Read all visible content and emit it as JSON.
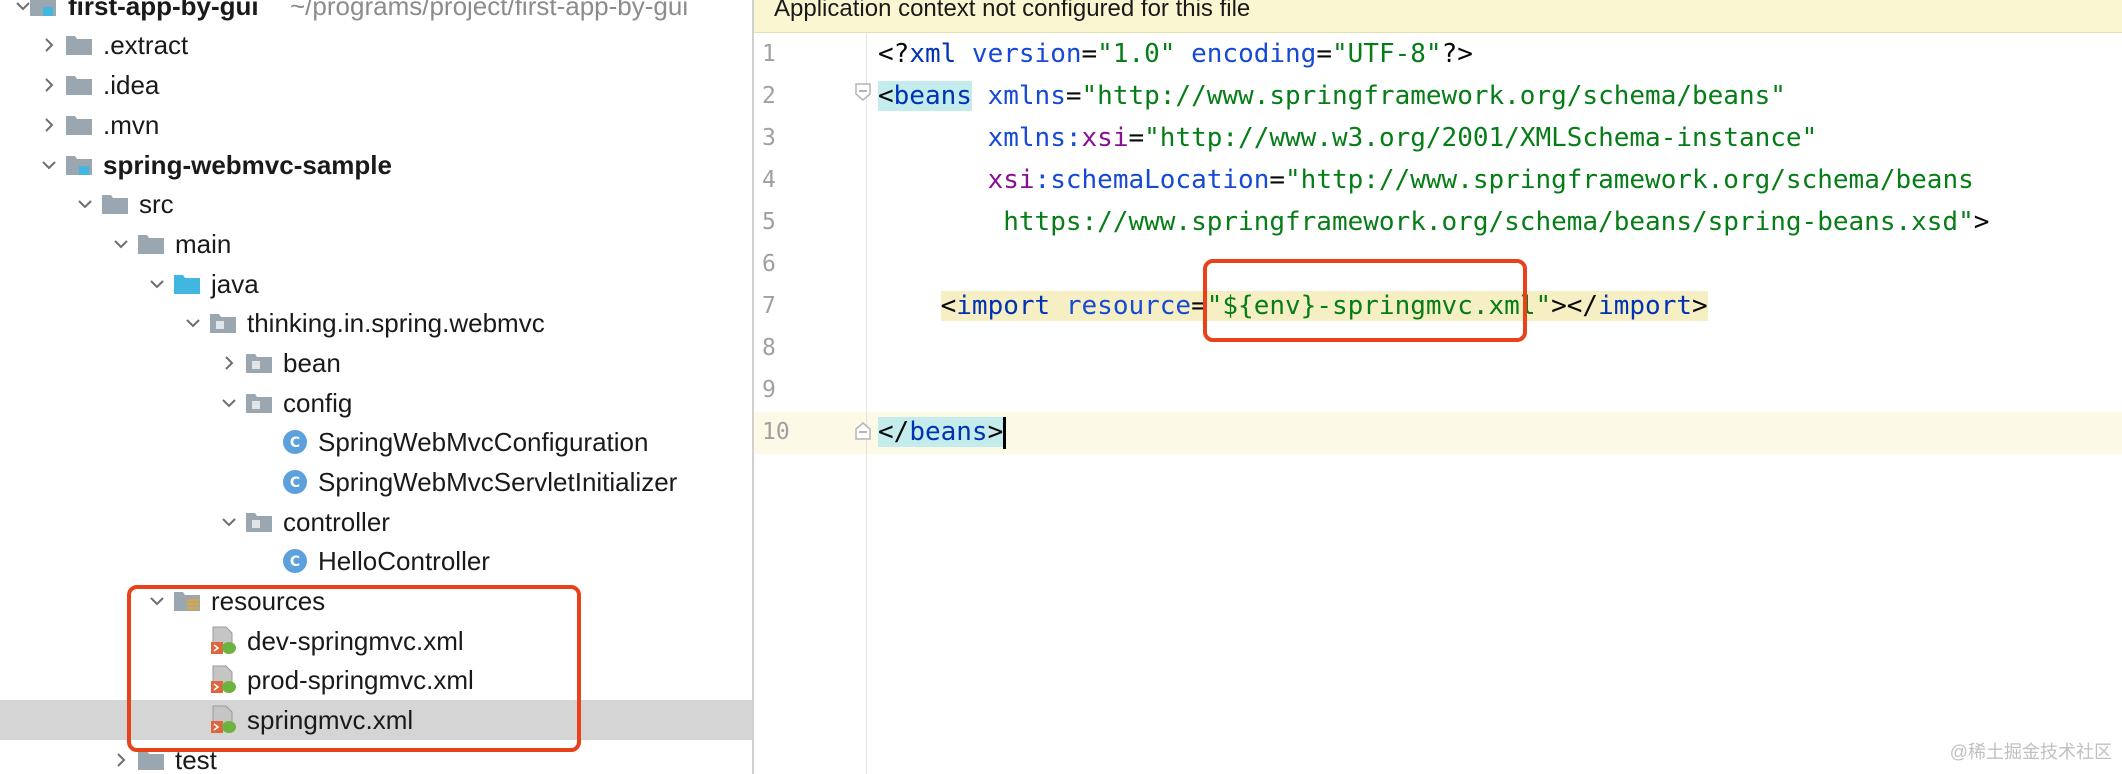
{
  "project_tree": {
    "rows": [
      {
        "label": "first-app-by-gui",
        "path": "~/programs/project/first-app-by-gui",
        "icon": "module-icon",
        "chevron": "down",
        "bold": true
      },
      {
        "label": ".extract",
        "icon": "folder-icon",
        "chevron": "right"
      },
      {
        "label": ".idea",
        "icon": "folder-icon",
        "chevron": "right"
      },
      {
        "label": ".mvn",
        "icon": "folder-icon",
        "chevron": "right"
      },
      {
        "label": "spring-webmvc-sample",
        "icon": "module-icon",
        "chevron": "down",
        "bold": true
      },
      {
        "label": "src",
        "icon": "folder-icon",
        "chevron": "down"
      },
      {
        "label": "main",
        "icon": "folder-icon",
        "chevron": "down"
      },
      {
        "label": "java",
        "icon": "source-folder-icon",
        "chevron": "down"
      },
      {
        "label": "thinking.in.spring.webmvc",
        "icon": "package-icon",
        "chevron": "down"
      },
      {
        "label": "bean",
        "icon": "package-icon",
        "chevron": "right"
      },
      {
        "label": "config",
        "icon": "package-icon",
        "chevron": "down"
      },
      {
        "label": "SpringWebMvcConfiguration",
        "icon": "class-icon",
        "chevron": "none"
      },
      {
        "label": "SpringWebMvcServletInitializer",
        "icon": "class-icon",
        "chevron": "none"
      },
      {
        "label": "controller",
        "icon": "package-icon",
        "chevron": "down"
      },
      {
        "label": "HelloController",
        "icon": "class-icon",
        "chevron": "none"
      },
      {
        "label": "resources",
        "icon": "resources-folder-icon",
        "chevron": "down"
      },
      {
        "label": "dev-springmvc.xml",
        "icon": "spring-xml-icon",
        "chevron": "none"
      },
      {
        "label": "prod-springmvc.xml",
        "icon": "spring-xml-icon",
        "chevron": "none"
      },
      {
        "label": "springmvc.xml",
        "icon": "spring-xml-icon",
        "chevron": "none",
        "selected": true
      },
      {
        "label": "test",
        "icon": "folder-icon",
        "chevron": "right"
      }
    ]
  },
  "editor": {
    "banner": "Application context not configured for this file",
    "line_numbers": [
      "1",
      "2",
      "3",
      "4",
      "5",
      "6",
      "7",
      "8",
      "9",
      "10"
    ],
    "lines": {
      "l1": {
        "a": "<?",
        "b": "xml",
        "c": " version",
        "d": "=",
        "e": "\"1.0\"",
        "f": " encoding",
        "g": "=",
        "h": "\"UTF-8\"",
        "i": "?>"
      },
      "l2": {
        "a": "<",
        "b": "beans",
        "c": " xmlns",
        "d": "=",
        "e": "\"http://www.springframework.org/schema/beans\""
      },
      "l3": {
        "a": "       ",
        "b": "xmlns",
        "c": ":",
        "d": "xsi",
        "e": "=",
        "f": "\"http://www.w3.org/2001/XMLSchema-instance\""
      },
      "l4": {
        "a": "       ",
        "b": "xsi",
        "c": ":schemaLocation",
        "d": "=",
        "e": "\"http://www.springframework.org/schema/beans"
      },
      "l5": {
        "a": "        ",
        "b": "https://www.springframework.org/schema/beans/spring-beans.xsd\"",
        "c": ">"
      },
      "l7": {
        "a": "    ",
        "b": "<",
        "c": "import",
        "d": " resource",
        "e": "=",
        "f": "\"${env}-springmvc.xml\"",
        "g": "></",
        "h": "import",
        "i": ">"
      },
      "l10": {
        "a": "</",
        "b": "beans",
        "c": ">"
      }
    }
  },
  "watermark": "@稀土掘金技术社区",
  "colors": {
    "highlight_box": "#e8421b",
    "banner_bg": "#fbf6d2",
    "selection_bg": "#d5d5d5"
  }
}
